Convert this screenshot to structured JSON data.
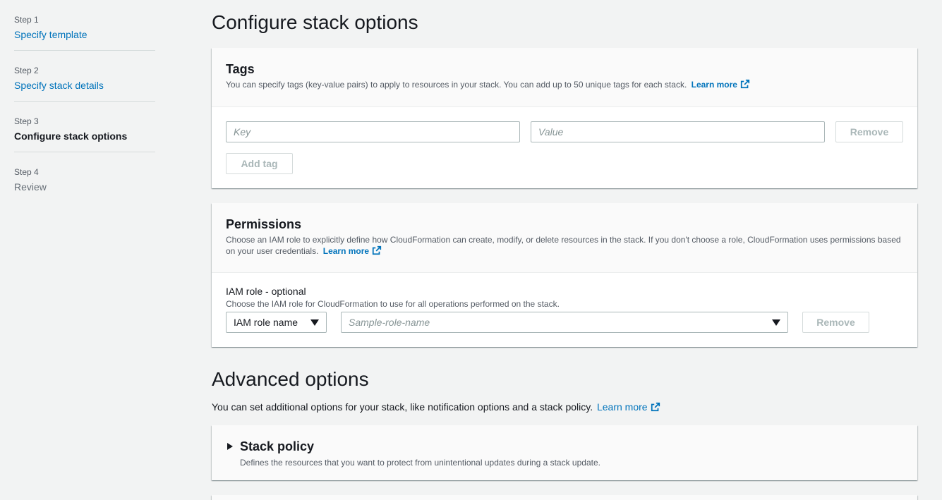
{
  "sidebar": {
    "steps": [
      {
        "num": "Step 1",
        "label": "Specify template",
        "state": "link"
      },
      {
        "num": "Step 2",
        "label": "Specify stack details",
        "state": "link"
      },
      {
        "num": "Step 3",
        "label": "Configure stack options",
        "state": "current"
      },
      {
        "num": "Step 4",
        "label": "Review",
        "state": "disabled"
      }
    ]
  },
  "page": {
    "title": "Configure stack options"
  },
  "tags": {
    "title": "Tags",
    "description": "You can specify tags (key-value pairs) to apply to resources in your stack. You can add up to 50 unique tags for each stack.",
    "learn_more": "Learn more",
    "key_placeholder": "Key",
    "value_placeholder": "Value",
    "remove_label": "Remove",
    "add_tag_label": "Add tag"
  },
  "permissions": {
    "title": "Permissions",
    "description": "Choose an IAM role to explicitly define how CloudFormation can create, modify, or delete resources in the stack. If you don't choose a role, CloudFormation uses permissions based on your user credentials.",
    "learn_more": "Learn more",
    "field_label": "IAM role - optional",
    "field_description": "Choose the IAM role for CloudFormation to use for all operations performed on the stack.",
    "role_type_selected": "IAM role name",
    "role_name_placeholder": "Sample-role-name",
    "remove_label": "Remove"
  },
  "advanced": {
    "title": "Advanced options",
    "description": "You can set additional options for your stack, like notification options and a stack policy.",
    "learn_more": "Learn more"
  },
  "stack_policy": {
    "title": "Stack policy",
    "description": "Defines the resources that you want to protect from unintentional updates during a stack update."
  },
  "colors": {
    "link": "#0073bb",
    "background": "#f2f3f3",
    "panel": "#ffffff",
    "disabled_text": "#aab7b8"
  }
}
